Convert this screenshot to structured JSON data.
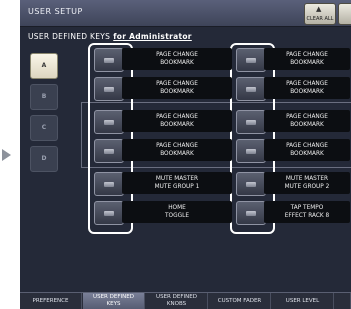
{
  "title": "USER SETUP",
  "clear_all_label": "CLEAR ALL",
  "subtitle": {
    "text": "USER DEFINED KEYS",
    "admin": "for Administrator"
  },
  "banks": [
    "A",
    "B",
    "C",
    "D"
  ],
  "rows": [
    {
      "left": [
        "PAGE CHANGE",
        "BOOKMARK"
      ],
      "right": [
        "PAGE CHANGE",
        "BOOKMARK"
      ]
    },
    {
      "left": [
        "PAGE CHANGE",
        "BOOKMARK"
      ],
      "right": [
        "PAGE CHANGE",
        "BOOKMARK"
      ]
    },
    {
      "left": [
        "PAGE CHANGE",
        "BOOKMARK"
      ],
      "right": [
        "PAGE CHANGE",
        "BOOKMARK"
      ]
    },
    {
      "left": [
        "PAGE CHANGE",
        "BOOKMARK"
      ],
      "right": [
        "PAGE CHANGE",
        "BOOKMARK"
      ]
    },
    {
      "left": [
        "MUTE MASTER",
        "MUTE GROUP 1"
      ],
      "right": [
        "MUTE MASTER",
        "MUTE GROUP 2"
      ]
    },
    {
      "left": [
        "HOME",
        "TOGGLE"
      ],
      "right": [
        "TAP TEMPO",
        "EFFECT RACK 8"
      ]
    }
  ],
  "tabs": [
    {
      "lines": [
        "PREFERENCE"
      ]
    },
    {
      "lines": [
        "USER DEFINED",
        "KEYS"
      ]
    },
    {
      "lines": [
        "USER DEFINED",
        "KNOBS"
      ]
    },
    {
      "lines": [
        "CUSTOM FADER"
      ]
    },
    {
      "lines": [
        "USER LEVEL"
      ]
    }
  ]
}
